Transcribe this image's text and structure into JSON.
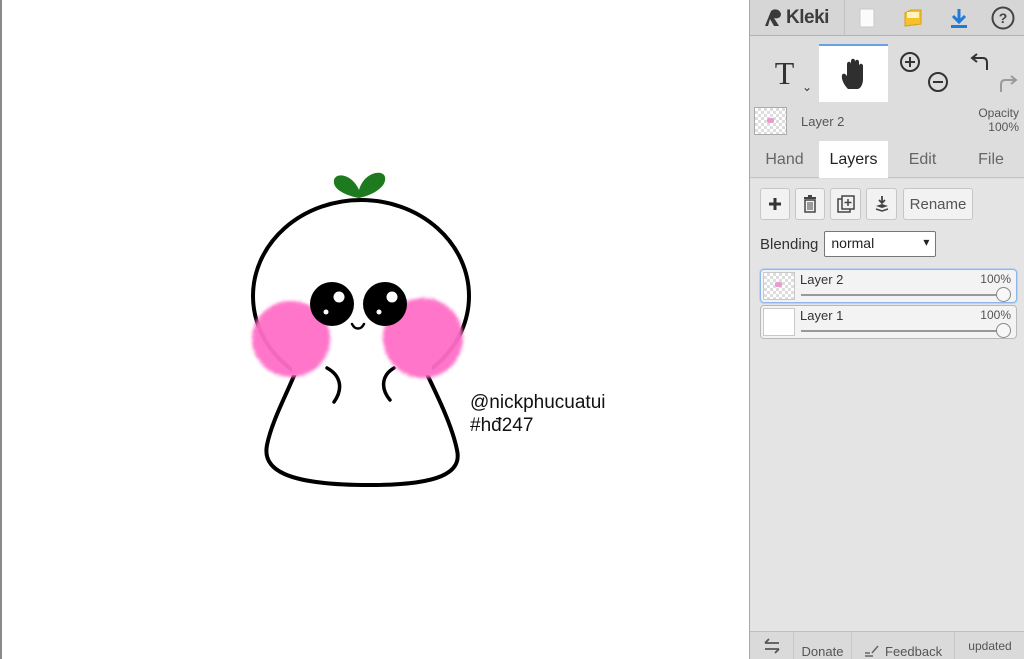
{
  "app": {
    "name": "Kleki"
  },
  "topbar": {
    "icons": [
      "kleki-logo-icon",
      "new-file-icon",
      "import-image-icon",
      "download-icon",
      "help-icon"
    ]
  },
  "tools": [
    {
      "name": "text-tool",
      "label": "T",
      "icon": "text-tool-icon",
      "active": false
    },
    {
      "name": "hand-tool",
      "icon": "hand-icon",
      "active": true
    },
    {
      "name": "zoom",
      "icons": [
        "zoom-in-icon",
        "zoom-out-icon"
      ]
    },
    {
      "name": "history",
      "icons": [
        "undo-icon",
        "redo-icon"
      ]
    }
  ],
  "current_layer": {
    "name": "Layer 2",
    "opacity_label": "Opacity",
    "opacity_value": "100%"
  },
  "tabs": [
    {
      "label": "Hand",
      "active": false
    },
    {
      "label": "Layers",
      "active": true
    },
    {
      "label": "Edit",
      "active": false
    },
    {
      "label": "File",
      "active": false
    }
  ],
  "layer_panel": {
    "buttons": [
      "add-layer-icon",
      "delete-layer-icon",
      "duplicate-layer-icon",
      "merge-down-icon"
    ],
    "rename_label": "Rename",
    "blending_label": "Blending",
    "blending_value": "normal",
    "layers": [
      {
        "name": "Layer 2",
        "opacity": "100%",
        "opacity_fraction": 1.0,
        "selected": true
      },
      {
        "name": "Layer 1",
        "opacity": "100%",
        "opacity_fraction": 1.0,
        "selected": false
      }
    ]
  },
  "canvas": {
    "text_line_1": "@nickphucuatui",
    "text_line_2": "#hđ247",
    "colors": {
      "cheek": "#ff6ec7",
      "sprout": "#1e7a1e",
      "outline": "#000000"
    }
  },
  "bottombar": {
    "swap_icon": "swap-arrows-icon",
    "donate": "Donate",
    "feedback_icon": "feedback-pen-icon",
    "feedback": "Feedback",
    "updated": "updated"
  }
}
